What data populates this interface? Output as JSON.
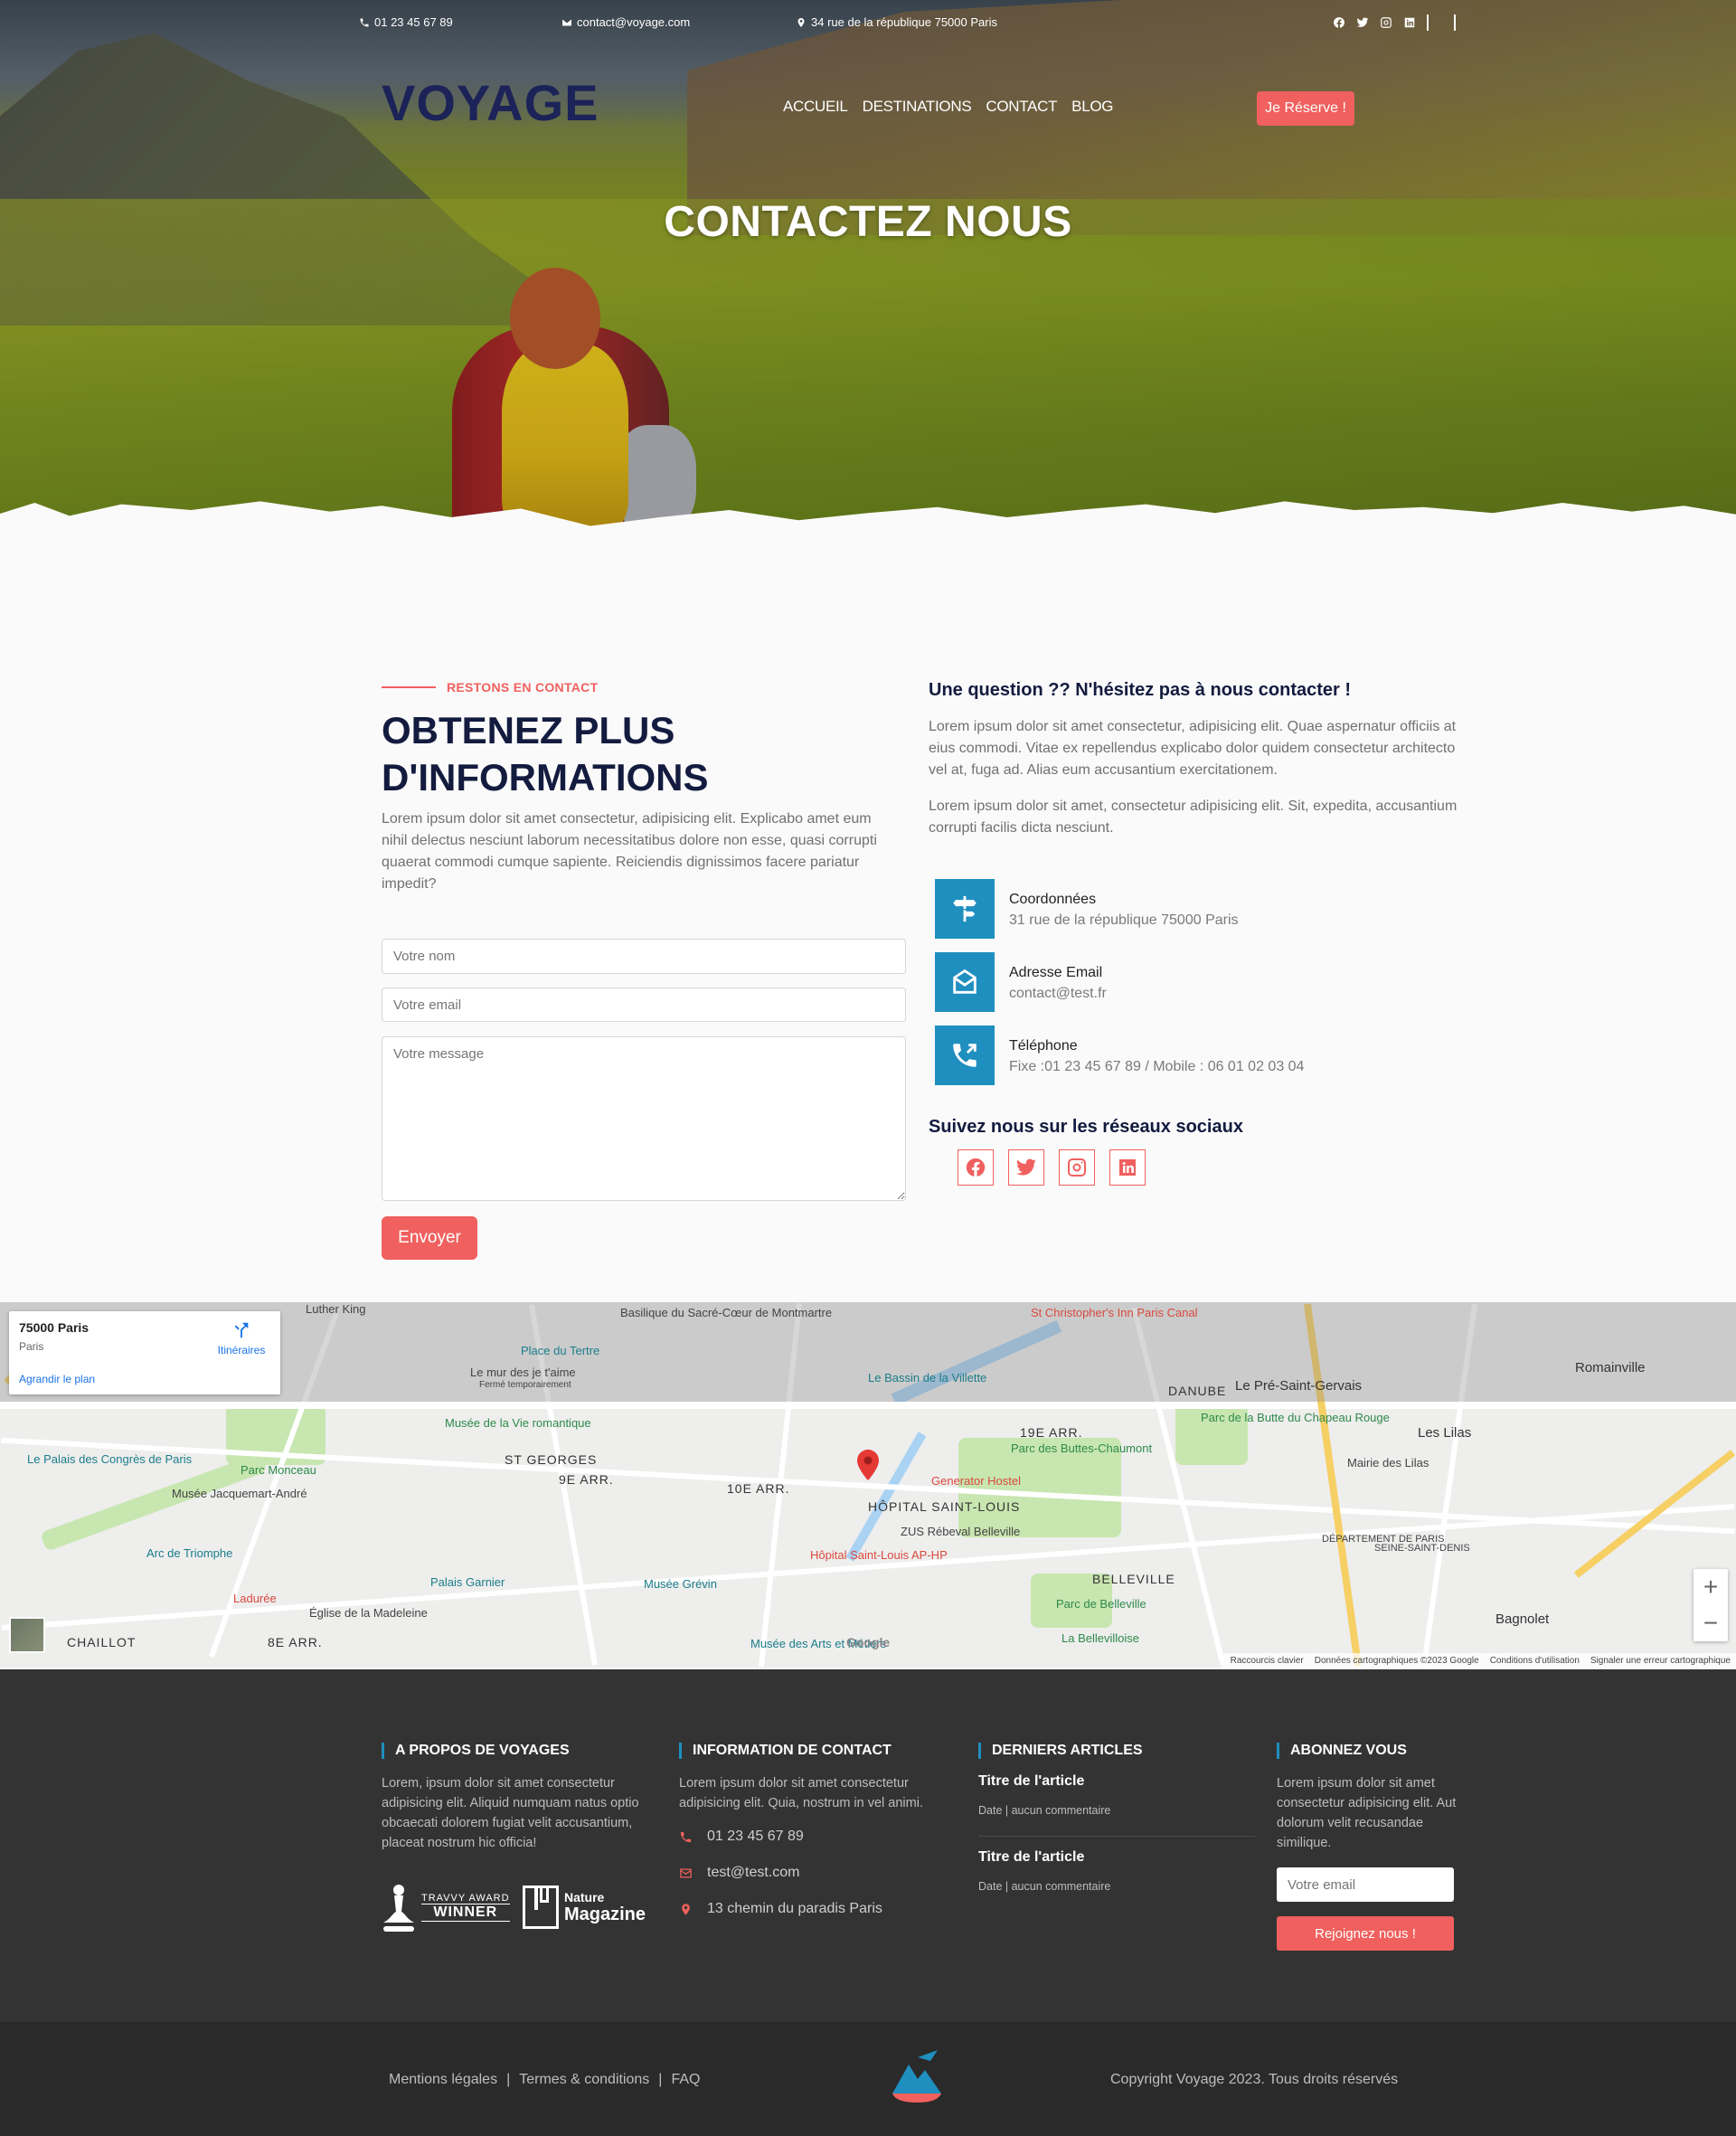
{
  "topbar": {
    "phone": "01 23 45 67 89",
    "email": "contact@voyage.com",
    "address": "34 rue de la république 75000 Paris",
    "social_icons": [
      "facebook-icon",
      "twitter-icon",
      "instagram-icon",
      "linkedin-icon"
    ]
  },
  "header": {
    "logo": "VOYAGE",
    "nav": [
      "ACCUEIL",
      "DESTINATIONS",
      "CONTACT",
      "BLOG"
    ],
    "cta": "Je Réserve !"
  },
  "hero": {
    "title": "CONTACTEZ NOUS"
  },
  "contact": {
    "kicker": "RESTONS EN CONTACT",
    "title": "OBTENEZ PLUS D'INFORMATIONS",
    "description": "Lorem ipsum dolor sit amet consectetur, adipisicing elit. Explicabo amet eum nihil delectus nesciunt laborum necessitatibus dolore non esse, quasi corrupti quaerat commodi cumque sapiente. Reiciendis dignissimos facere pariatur impedit?",
    "form": {
      "name_placeholder": "Votre nom",
      "email_placeholder": "Votre email",
      "message_placeholder": "Votre message",
      "submit": "Envoyer"
    },
    "question_title": "Une question ?? N'hésitez pas à nous contacter !",
    "question_para1": "Lorem ipsum dolor sit amet consectetur, adipisicing elit. Quae aspernatur officiis at eius commodi. Vitae ex repellendus explicabo dolor quidem consectetur architecto vel at, fuga ad. Alias eum accusantium exercitationem.",
    "question_para2": "Lorem ipsum dolor sit amet, consectetur adipisicing elit. Sit, expedita, accusantium corrupti facilis dicta nesciunt.",
    "info": [
      {
        "icon": "signpost-icon",
        "label": "Coordonnées",
        "value": "31 rue de la république 75000 Paris"
      },
      {
        "icon": "envelope-icon",
        "label": "Adresse Email",
        "value": "contact@test.fr"
      },
      {
        "icon": "phone-icon",
        "label": "Téléphone",
        "value": "Fixe :01 23 45 67 89 / Mobile : 06 01 02 03 04"
      }
    ],
    "social_title": "Suivez nous sur les réseaux sociaux",
    "social": [
      "facebook-icon",
      "twitter-icon",
      "instagram-icon",
      "linkedin-icon"
    ]
  },
  "map": {
    "card_title": "75000 Paris",
    "card_subtitle": "Paris",
    "card_link": "Agrandir le plan",
    "directions": "Itinéraires",
    "labels": [
      "Basilique du Sacré-Cœur de Montmartre",
      "St Christopher's Inn Paris Canal",
      "Place du Tertre",
      "Le mur des je t'aime",
      "Fermé temporairement",
      "Le Bassin de la Villette",
      "DANUBE",
      "Le Pré-Saint-Gervais",
      "Romainville",
      "Musée de la Vie romantique",
      "ST GEORGES",
      "9E ARR.",
      "10E ARR.",
      "19E ARR.",
      "Parc des Buttes-Chaumont",
      "Parc de la Butte du Chapeau Rouge",
      "Les Lilas",
      "Mairie des Lilas",
      "Le Palais des Congrès de Paris",
      "Parc Monceau",
      "Musée Jacquemart-André",
      "Generator Hostel",
      "HÔPITAL SAINT-LOUIS",
      "ZUS Rébeval Belleville",
      "Hôpital Saint-Louis AP-HP",
      "Arc de Triomphe",
      "Palais Garnier",
      "Musée Grévin",
      "BELLEVILLE",
      "DÉPARTEMENT DE PARIS",
      "SEINE-SAINT-DENIS",
      "Ladurée",
      "Église de la Madeleine",
      "Parc de Belleville",
      "La Bellevilloise",
      "Bagnolet",
      "CHAILLOT",
      "8E ARR.",
      "Musée des Arts et Métiers",
      "Luther King"
    ],
    "footer": [
      "Raccourcis clavier",
      "Données cartographiques ©2023 Google",
      "Conditions d'utilisation",
      "Signaler une erreur cartographique"
    ],
    "google": "Google"
  },
  "footer": {
    "about_title": "A PROPOS DE VOYAGES",
    "about_text": "Lorem, ipsum dolor sit amet consectetur adipisicing elit. Aliquid numquam natus optio obcaecati dolorem fugiat velit accusantium, placeat nostrum hic officia!",
    "badge1_line1": "TRAVVY AWARD",
    "badge1_line2": "WINNER",
    "badge2_line1": "Nature",
    "badge2_line2": "Magazine",
    "contact_title": "INFORMATION DE CONTACT",
    "contact_text": "Lorem ipsum dolor sit amet consectetur adipisicing elit. Quia, nostrum in vel animi.",
    "contact_phone": "01 23 45 67 89",
    "contact_email": "test@test.com",
    "contact_address": "13 chemin du paradis Paris",
    "articles_title": "DERNIERS ARTICLES",
    "articles": [
      {
        "title": "Titre de l'article",
        "meta": "Date | aucun commentaire"
      },
      {
        "title": "Titre de l'article",
        "meta": "Date | aucun commentaire"
      }
    ],
    "subscribe_title": "ABONNEZ VOUS",
    "subscribe_text": "Lorem ipsum dolor sit amet consectetur adipisicing elit. Aut dolorum velit recusandae similique.",
    "subscribe_placeholder": "Votre email",
    "subscribe_button": "Rejoignez nous !",
    "bottom_links": [
      "Mentions légales",
      "Termes & conditions",
      "FAQ"
    ],
    "copyright": "Copyright Voyage 2023. Tous droits réservés"
  },
  "colors": {
    "accent": "#f0605e",
    "blue": "#1f8fc0",
    "navy": "#131b3f",
    "footer": "#333333"
  }
}
